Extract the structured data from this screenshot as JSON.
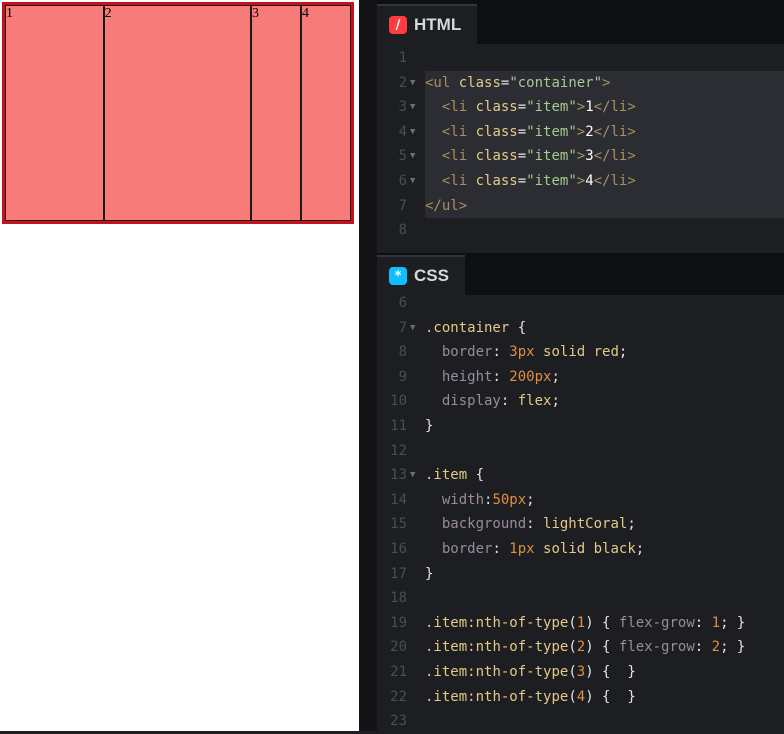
{
  "preview": {
    "items": [
      {
        "label": "1",
        "flex": 1
      },
      {
        "label": "2",
        "flex": 2
      },
      {
        "label": "3",
        "flex": 0
      },
      {
        "label": "4",
        "flex": 0
      }
    ]
  },
  "html_pane": {
    "tab_label": "HTML",
    "icon": "slash-icon",
    "line_numbers": [
      "1",
      "2",
      "3",
      "4",
      "5",
      "6",
      "7",
      "8"
    ],
    "lines": [
      "",
      "<ul class=\"container\">",
      "  <li class=\"item\">1</li>",
      "  <li class=\"item\">2</li>",
      "  <li class=\"item\">3</li>",
      "  <li class=\"item\">4</li>",
      "</ul>",
      ""
    ]
  },
  "css_pane": {
    "tab_label": "CSS",
    "icon": "asterisk-icon",
    "line_numbers": [
      "6",
      "7",
      "8",
      "9",
      "10",
      "11",
      "12",
      "13",
      "14",
      "15",
      "16",
      "17",
      "18",
      "19",
      "20",
      "21",
      "22",
      "23"
    ],
    "lines": [
      "",
      ".container {",
      "  border: 3px solid red;",
      "  height: 200px;",
      "  display: flex;",
      "}",
      "",
      ".item {",
      "  width:50px;",
      "  background: lightCoral;",
      "  border: 1px solid black;",
      "}",
      "",
      ".item:nth-of-type(1) { flex-grow: 1; }",
      ".item:nth-of-type(2) { flex-grow: 2; }",
      ".item:nth-of-type(3) {  }",
      ".item:nth-of-type(4) {  }",
      ""
    ]
  }
}
